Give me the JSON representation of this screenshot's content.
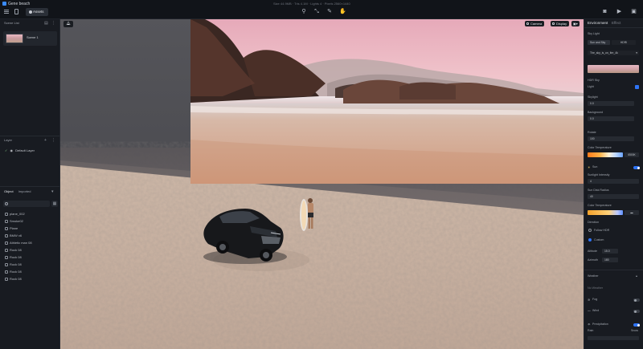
{
  "app": {
    "title": "Gene beach",
    "assets_label": "Assets",
    "stats": "Size 44.9MB · Tris 4.1M · Lights 4 · Pixels 2560×1440"
  },
  "left": {
    "scene_list_label": "Scene List",
    "scene_name": "Scene 1",
    "layer_label": "Layer",
    "default_layer": "Default Layer",
    "object_tab": "Object",
    "imported_tab": "Imported",
    "search_placeholder": "",
    "objects": [
      "plane_002",
      "Smoke02",
      "Plane",
      "BMW x6",
      "Athletic man 08",
      "Rock 08",
      "Rock 08",
      "Rock 08",
      "Rock 08",
      "Rock 08"
    ]
  },
  "viewport": {
    "camera_label": "Camera",
    "display_label": "Display"
  },
  "right": {
    "tab_environment": "Environment",
    "tab_effect": "Effect",
    "sky_light_label": "Sky Light",
    "sky_mode_a": "Sun and Sky",
    "sky_mode_b": "HDRI",
    "hdri_name": "The_sky_is_on_fire_4k",
    "hdr_sky_label": "HDR Sky",
    "light_label": "Light",
    "skylight_label": "Skylight",
    "skylight_value": "0.0",
    "background_label": "Background",
    "background_value": "0.0",
    "rotate_label": "Rotate",
    "rotate_value": "100",
    "color_temp_label": "Color Temperature",
    "color_temp_value": "6500K",
    "sun_label": "Sun",
    "sunlight_intensity_label": "Sunlight Intensity",
    "sunlight_intensity_value": "4",
    "sun_disk_label": "Sun Disk Radius",
    "sun_disk_value": "40",
    "color_temp2_label": "Color Temperature",
    "direction_label": "Direction",
    "follow_hdr_label": "Follow HDR",
    "custom_label": "Custom",
    "altitude_label": "Altitude",
    "altitude_value": "15.0",
    "azimuth_label": "Azimuth",
    "azimuth_value": "180",
    "weather_label": "Weather",
    "no_weather_label": "No Weather",
    "fog_label": "Fog",
    "wind_label": "Wind",
    "precipitation_label": "Precipitation",
    "rain_label": "Rain",
    "snow_label": "Snow"
  },
  "colors": {
    "accent": "#2f74f6",
    "panel_bg": "#181b21",
    "top_bar_bg": "#111419"
  }
}
